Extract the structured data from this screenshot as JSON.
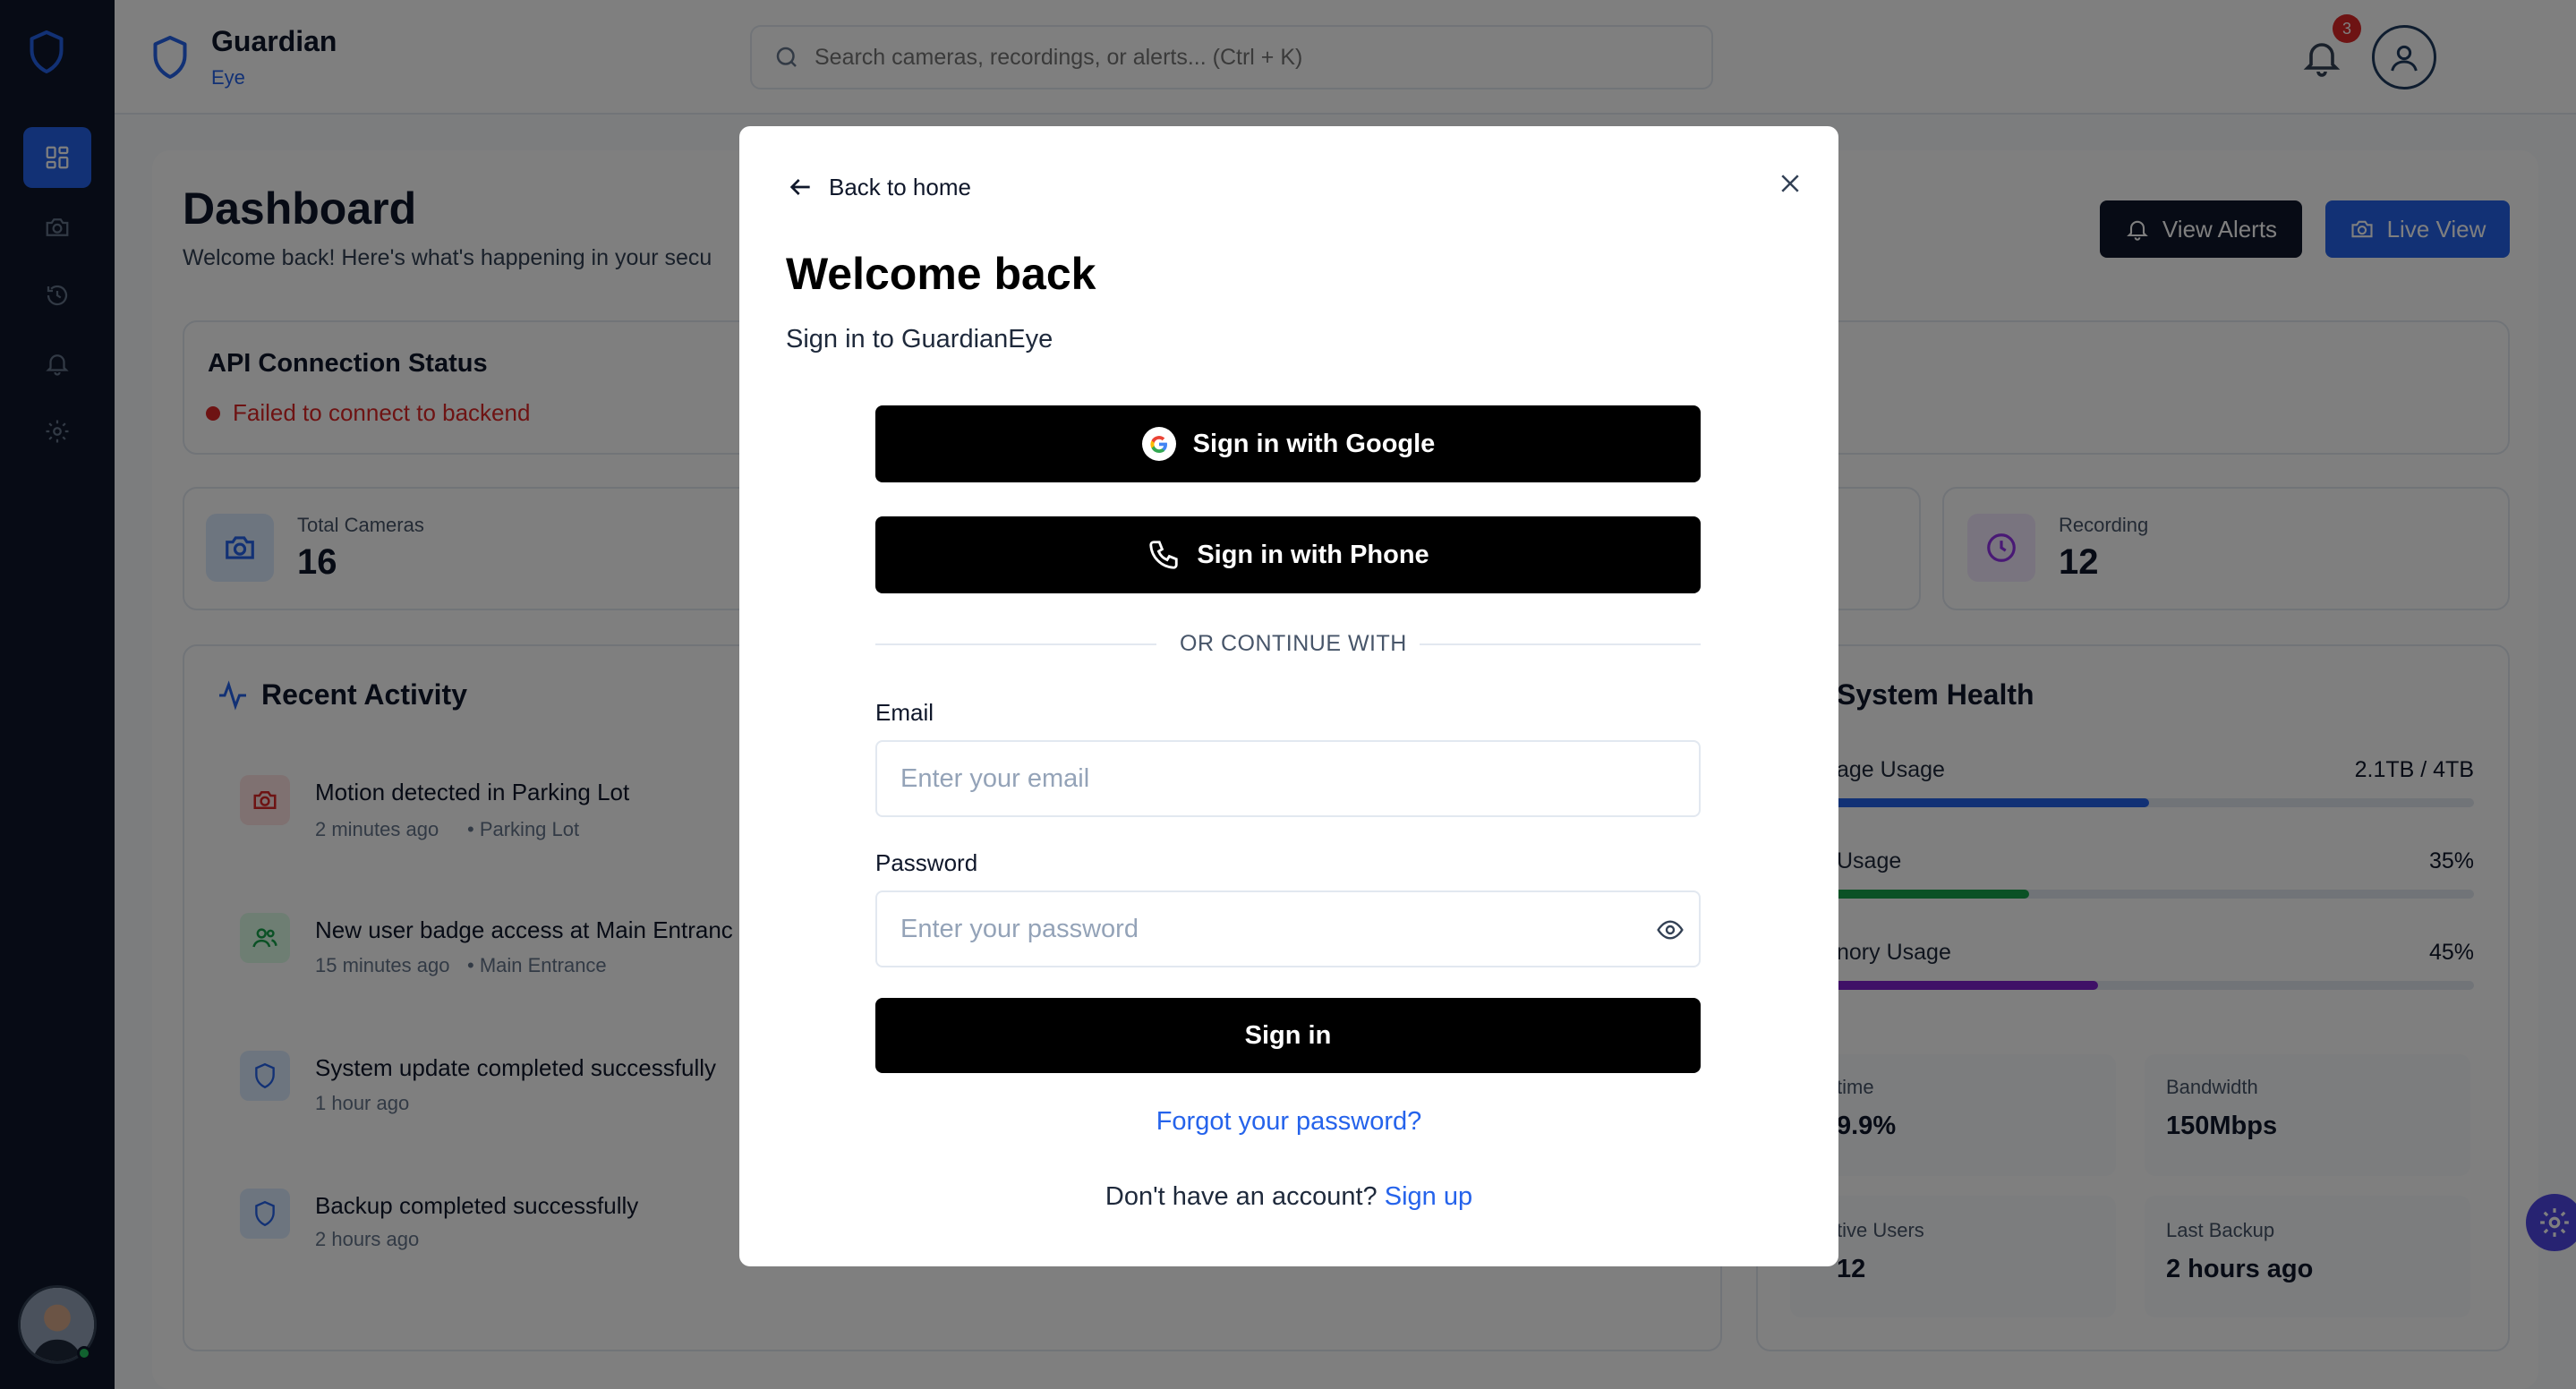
{
  "brand": {
    "name": "Guardian",
    "sub": "Eye"
  },
  "search": {
    "placeholder": "Search cameras, recordings, or alerts... (Ctrl + K)"
  },
  "notifications": {
    "count": "3"
  },
  "dashboard": {
    "title": "Dashboard",
    "subtitle": "Welcome back! Here's what's happening in your secu",
    "view_alerts": "View Alerts",
    "live_view": "Live View"
  },
  "api": {
    "title": "API Connection Status",
    "status": "Failed to connect to backend"
  },
  "stats": {
    "cameras": {
      "label": "Total Cameras",
      "value": "16"
    },
    "recording": {
      "label": "Recording",
      "value": "12"
    }
  },
  "activity": {
    "title": "Recent Activity",
    "items": [
      {
        "title": "Motion detected in Parking Lot",
        "time": "2 minutes ago",
        "location": "• Parking Lot"
      },
      {
        "title": "New user badge access at Main Entranc",
        "time": "15 minutes ago",
        "location": "• Main Entrance"
      },
      {
        "title": "System update completed successfully",
        "time": "1 hour ago",
        "location": ""
      },
      {
        "title": "Backup completed successfully",
        "time": "2 hours ago",
        "location": ""
      }
    ]
  },
  "health": {
    "title": "System Health",
    "bars": [
      {
        "label": "age Usage",
        "value": "2.1TB / 4TB",
        "fraction": 0.525,
        "color": "#2563eb"
      },
      {
        "label": " Usage",
        "value": "35%",
        "fraction": 0.35,
        "color": "#16a34a"
      },
      {
        "label": "nory Usage",
        "value": "45%",
        "fraction": 0.45,
        "color": "#7e22ce"
      }
    ],
    "tiles": [
      {
        "label": "time",
        "value": "9.9%"
      },
      {
        "label": "Bandwidth",
        "value": "150Mbps"
      },
      {
        "label": "tive Users",
        "value": "12"
      },
      {
        "label": "Last Backup",
        "value": "2 hours ago"
      }
    ]
  },
  "modal": {
    "back": "Back to home",
    "title": "Welcome back",
    "subtitle": "Sign in to GuardianEye",
    "google": "Sign in with Google",
    "phone": "Sign in with Phone",
    "divider": "OR CONTINUE WITH",
    "email_label": "Email",
    "email_placeholder": "Enter your email",
    "password_label": "Password",
    "password_placeholder": "Enter your password",
    "submit": "Sign in",
    "forgot": "Forgot your password?",
    "no_account": "Don't have an account?",
    "signup": "Sign up"
  },
  "colors": {
    "accent": "#2563eb",
    "sidebar": "#0f172a",
    "error": "#dc2626"
  }
}
